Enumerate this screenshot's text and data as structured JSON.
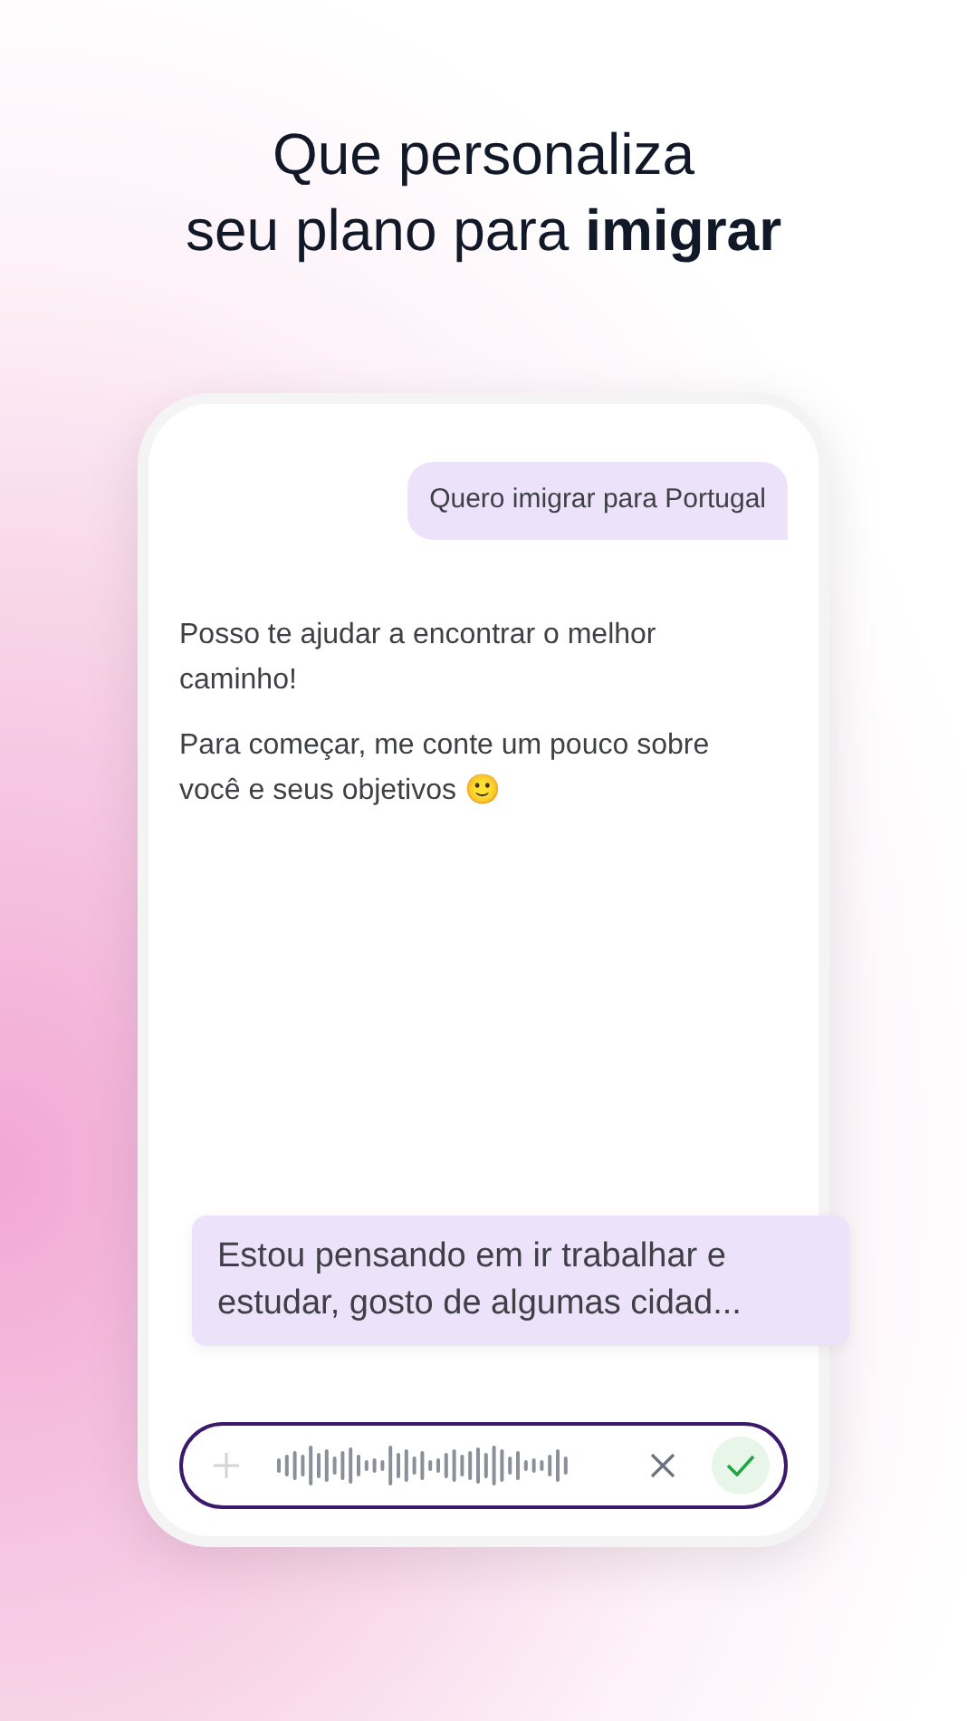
{
  "headline": [
    "Que personaliza",
    "seu plano para **imigrar**"
  ],
  "chat": {
    "messages": [
      {
        "kind": "user",
        "paragraphs": [
          "Quero imigrar para Portugal"
        ]
      },
      {
        "kind": "assistant",
        "paragraphs": [
          "Posso te ajudar a encontrar o melhor caminho!",
          "Para começar, me conte um pouco sobre você e seus objetivos 🙂"
        ]
      }
    ]
  },
  "transcript": "Estou pensando em ir trabalhar e estudar, gosto de algumas cidad...",
  "composer": {
    "recording": true
  }
}
